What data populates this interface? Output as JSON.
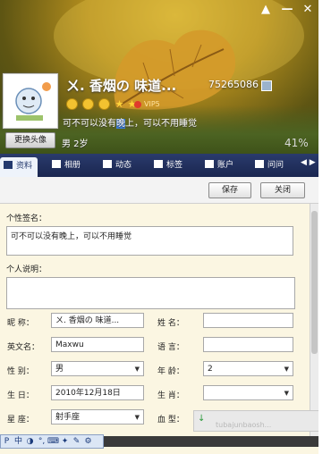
{
  "header": {
    "nickname": "ㄨ. 香烟の 味道...",
    "qq_number": "75265086",
    "vip_label": "VIP5",
    "signature_before": "可不可以没有",
    "signature_highlight": "晚",
    "signature_after": "上，可以不用睡觉",
    "gender_age": "男  2岁",
    "percent": "41%",
    "change_avatar": "更换头像",
    "star_symbol": "★"
  },
  "window_controls": [
    "▲",
    "—",
    "✕"
  ],
  "tabs": [
    {
      "label": "资料",
      "icon": "profile-icon"
    },
    {
      "label": "相册",
      "icon": "album-icon"
    },
    {
      "label": "动态",
      "icon": "feed-icon"
    },
    {
      "label": "标签",
      "icon": "tag-icon"
    },
    {
      "label": "账户",
      "icon": "account-icon"
    },
    {
      "label": "问问",
      "icon": "question-icon"
    }
  ],
  "tab_arrows": "◀ ▶",
  "actions": {
    "save": "保存",
    "close": "关闭"
  },
  "profile": {
    "signature_label": "个性签名：",
    "signature_value": "可不可以没有晚上，可以不用睡觉",
    "description_label": "个人说明：",
    "nickname_label": "昵  称：",
    "nickname_value": "ㄨ. 香烟の 味道...",
    "name_label": "姓  名：",
    "english_name_label": "英文名：",
    "english_name_value": "Maxwu",
    "language_label": "语  言：",
    "gender_label": "性  别：",
    "gender_value": "男",
    "age_label": "年  龄：",
    "age_value": "2",
    "birthday_label": "生  日：",
    "birthday_value": "2010年12月18日",
    "zodiac_label": "生  肖：",
    "constellation_label": "星  座：",
    "constellation_value": "射手座",
    "blood_label": "血  型："
  },
  "ime": {
    "buttons": [
      "P",
      "中",
      "◑",
      "°,",
      "⌨",
      "✦",
      "✎",
      "⚙"
    ]
  },
  "watermark": "tubajunbaosh..."
}
